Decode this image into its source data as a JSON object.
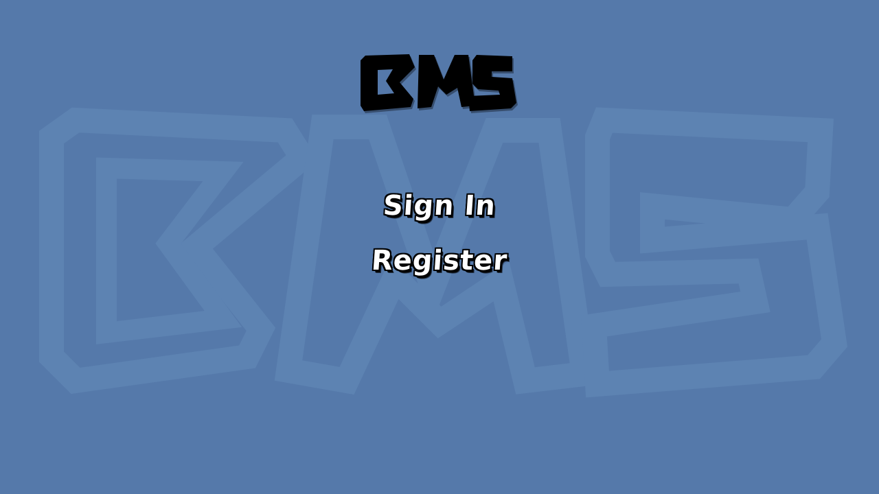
{
  "app": {
    "logo_text": "BMS",
    "background_watermark_text": "BMS"
  },
  "menu": {
    "items": [
      {
        "label": "Sign In"
      },
      {
        "label": "Register"
      }
    ]
  },
  "colors": {
    "background": "#5579aa",
    "watermark_stroke": "#5d83b2",
    "logo": "#000000",
    "menu_text": "#ffffff",
    "menu_outline": "#000000"
  }
}
